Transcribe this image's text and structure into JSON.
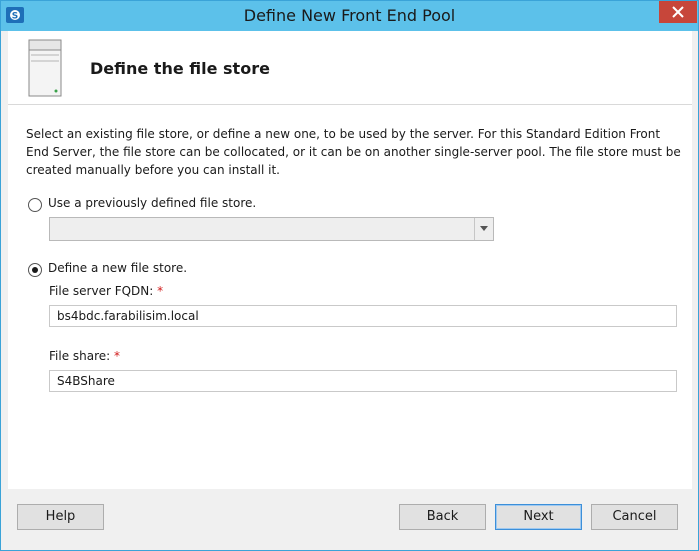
{
  "window": {
    "title": "Define New Front End Pool",
    "colors": {
      "titlebar": "#5cc1ea",
      "close": "#c7463a"
    }
  },
  "header": {
    "title": "Define the file store",
    "icon": "server-icon"
  },
  "description": "Select an existing file store, or define a new one, to be used by the server. For this Standard Edition Front End Server, the file store can be collocated, or it can be on another single-server pool. The file store must be created manually before you can install it.",
  "options": {
    "existing": {
      "label": "Use a previously defined file store.",
      "selected": false,
      "combo_value": ""
    },
    "new": {
      "label": "Define a new file store.",
      "selected": true
    }
  },
  "fields": {
    "fqdn": {
      "label": "File server FQDN:",
      "required_mark": "*",
      "value": "bs4bdc.farabilisim.local"
    },
    "share": {
      "label": "File share:",
      "required_mark": "*",
      "value": "S4BShare"
    }
  },
  "buttons": {
    "help": "Help",
    "back": "Back",
    "next": "Next",
    "cancel": "Cancel"
  }
}
